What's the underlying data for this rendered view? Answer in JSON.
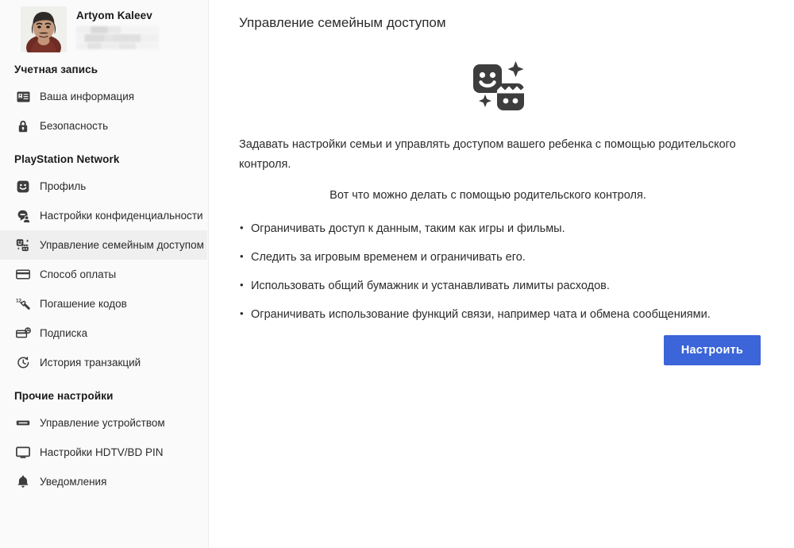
{
  "account": {
    "name": "Artyom Kaleev",
    "avatar_icon": "user-photo-avatar",
    "redacted_block": "redacted-account-details"
  },
  "sidebar": {
    "sections": [
      {
        "title": "Учетная запись",
        "items": [
          {
            "label": "Ваша информация",
            "icon": "id-card-icon",
            "active": false
          },
          {
            "label": "Безопасность",
            "icon": "lock-icon",
            "active": false
          }
        ]
      },
      {
        "title": "PlayStation Network",
        "items": [
          {
            "label": "Профиль",
            "icon": "smiley-profile-icon",
            "active": false
          },
          {
            "label": "Настройки конфиденциальности",
            "icon": "privacy-person-icon",
            "active": false
          },
          {
            "label": "Управление семейным доступом",
            "icon": "family-icon",
            "active": true
          },
          {
            "label": "Способ оплаты",
            "icon": "credit-card-icon",
            "active": false
          },
          {
            "label": "Погашение кодов",
            "icon": "redeem-code-icon",
            "active": false
          },
          {
            "label": "Подписка",
            "icon": "subscription-icon",
            "active": false
          },
          {
            "label": "История транзакций",
            "icon": "history-clock-icon",
            "active": false
          }
        ]
      },
      {
        "title": "Прочие настройки",
        "items": [
          {
            "label": "Управление устройством",
            "icon": "device-icon",
            "active": false
          },
          {
            "label": "Настройки HDTV/BD PIN",
            "icon": "monitor-icon",
            "active": false
          },
          {
            "label": "Уведомления",
            "icon": "bell-icon",
            "active": false
          }
        ]
      }
    ]
  },
  "main": {
    "title": "Управление семейным доступом",
    "hero_icon": "family-parental-control-icon",
    "intro": "Задавать настройки семьи и управлять доступом вашего ребенка с помощью родительского контроля.",
    "subheading": "Вот что можно делать с помощью родительского контроля.",
    "bullets": [
      "Ограничивать доступ к данным, таким как игры и фильмы.",
      "Следить за игровым временем и ограничивать его.",
      "Использовать общий бумажник и устанавливать лимиты расходов.",
      "Ограничивать использование функций связи, например чата и обмена сообщениями."
    ],
    "primary_button": "Настроить"
  },
  "colors": {
    "accent": "#3b65d8",
    "sidebar_bg": "#fafafa",
    "active_item_bg": "#efefef",
    "text": "#2b2b2b",
    "icon": "#3d3d3d"
  }
}
